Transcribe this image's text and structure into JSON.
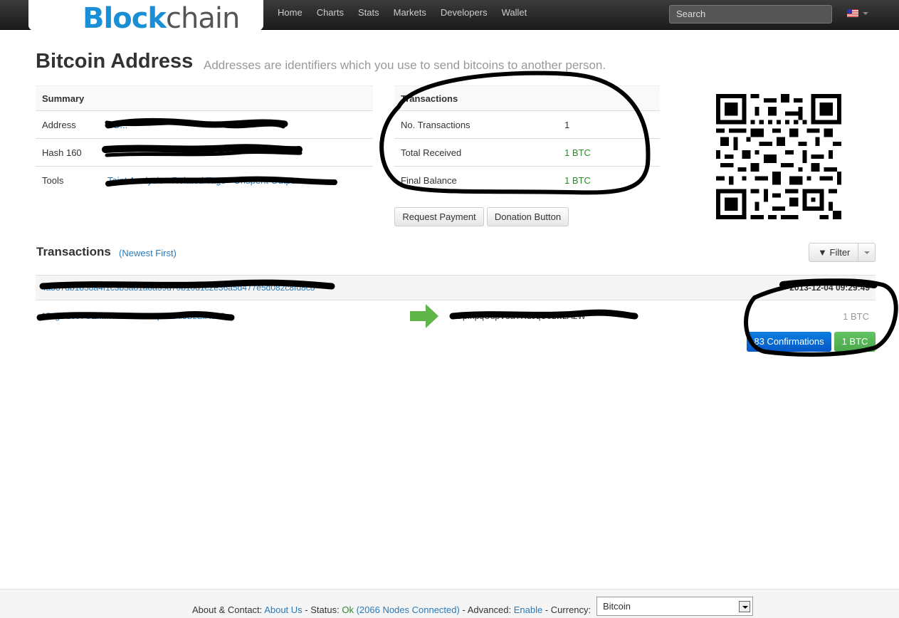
{
  "brand": {
    "logo_part1": "Bl",
    "logo_part2": "ck",
    "logo_part3": "chain"
  },
  "nav": {
    "items": [
      "Home",
      "Charts",
      "Stats",
      "Markets",
      "Developers",
      "Wallet"
    ]
  },
  "search": {
    "placeholder": "Search"
  },
  "header": {
    "title": "Bitcoin Address",
    "subtitle": "Addresses are identifiers which you use to send bitcoins to another person."
  },
  "summary": {
    "heading": "Summary",
    "rows": [
      {
        "label": "Address",
        "value": "1G..."
      },
      {
        "label": "Hash 160",
        "value": ""
      },
      {
        "label": "Tools",
        "value": "Taint Analysis - Related Tags - Unspent Outputs"
      }
    ]
  },
  "transactions_summary": {
    "heading": "Transactions",
    "rows": [
      {
        "label": "No. Transactions",
        "value": "1"
      },
      {
        "label": "Total Received",
        "value": "1 BTC"
      },
      {
        "label": "Final Balance",
        "value": "1 BTC"
      }
    ]
  },
  "buttons": {
    "request_payment": "Request Payment",
    "donation_button": "Donation Button"
  },
  "transactions": {
    "heading": "Transactions",
    "order": "(Newest First)",
    "filter_label": "Filter",
    "list": [
      {
        "hash": "4a537db1838a4f1c3b3a81a8a39d70b10d1c2e36a5d477e5d082c8fd8c8",
        "time": "2013-12-04 09:29:49",
        "from": "15zgC2697GZMMTRED9bX5qK9LAf5BzEfAcxC",
        "to": "1GpfnpqUupV8aYRdJqUoLw2A2W",
        "amount": "1 BTC",
        "confirmations": "83 Confirmations",
        "result": "1 BTC"
      }
    ]
  },
  "footer": {
    "about_label": "About & Contact:",
    "about_link": "About Us",
    "status_label": "Status:",
    "status_value": "Ok",
    "nodes": "(2066 Nodes Connected)",
    "advanced_label": "Advanced:",
    "advanced_link": "Enable",
    "currency_label": "Currency:",
    "currency_value": "Bitcoin"
  },
  "colors": {
    "brand_blue": "#1a8fd6",
    "link": "#2a7ab8",
    "green": "#2b8a2b",
    "confirm_blue": "#0a7fe0",
    "success_green": "#5bb75b"
  }
}
